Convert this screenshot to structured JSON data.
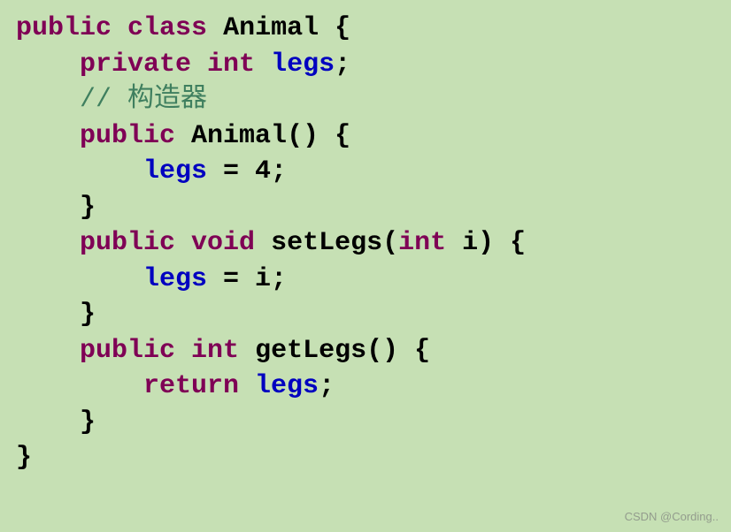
{
  "code": {
    "l1_public": "public",
    "l1_class": "class",
    "l1_name": "Animal",
    "l1_brace": " {",
    "l2_private": "private",
    "l2_int": "int",
    "l2_var": "legs",
    "l2_semi": ";",
    "l3_comment": "// 构造器",
    "l4_public": "public",
    "l4_name": "Animal",
    "l4_paren": "() {",
    "l5_var": "legs",
    "l5_eq": " = ",
    "l5_val": "4",
    "l5_semi": ";",
    "l6_close": "}",
    "l7_public": "public",
    "l7_void": "void",
    "l7_method": "setLegs",
    "l7_paren_open": "(",
    "l7_int": "int",
    "l7_param": " i",
    "l7_paren_close": ") {",
    "l8_var": "legs",
    "l8_eq": " = ",
    "l8_val": "i",
    "l8_semi": ";",
    "l9_close": "}",
    "l10_public": "public",
    "l10_int": "int",
    "l10_method": "getLegs",
    "l10_paren": "() {",
    "l11_return": "return",
    "l11_var": "legs",
    "l11_semi": ";",
    "l12_close": "}",
    "l13_close": "}"
  },
  "watermark": "CSDN @Cording.."
}
